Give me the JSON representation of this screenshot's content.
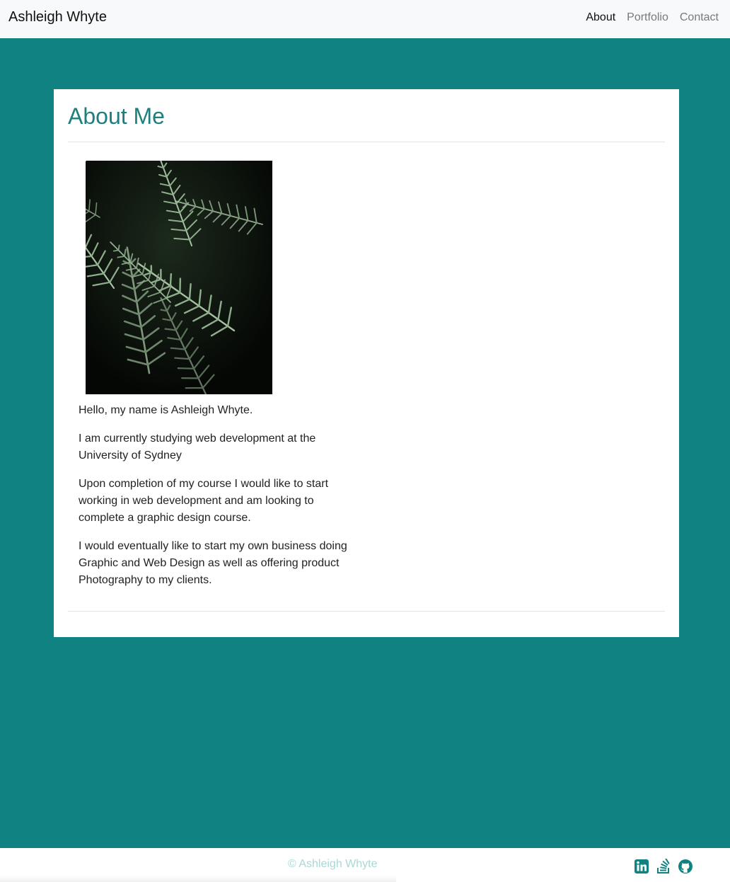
{
  "nav": {
    "brand": "Ashleigh Whyte",
    "links": [
      {
        "label": "About"
      },
      {
        "label": "Portfolio"
      },
      {
        "label": "Contact"
      }
    ]
  },
  "about": {
    "title": "About Me",
    "paragraphs": [
      "Hello, my name is Ashleigh Whyte.",
      "I am currently studying web development at the University of Sydney",
      "Upon completion of my course I would like to start working in web development and am looking to complete a graphic design course.",
      "I would eventually like to start my own business doing Graphic and Web Design as well as offering product Photography to my clients."
    ]
  },
  "footer": {
    "copyright": "© Ashleigh Whyte",
    "social_icons": [
      "linkedin-icon",
      "stackoverflow-icon",
      "github-icon"
    ]
  },
  "colors": {
    "background": "#118282",
    "heading": "#1f7f7c",
    "footer_text": "#a9d8d6"
  }
}
